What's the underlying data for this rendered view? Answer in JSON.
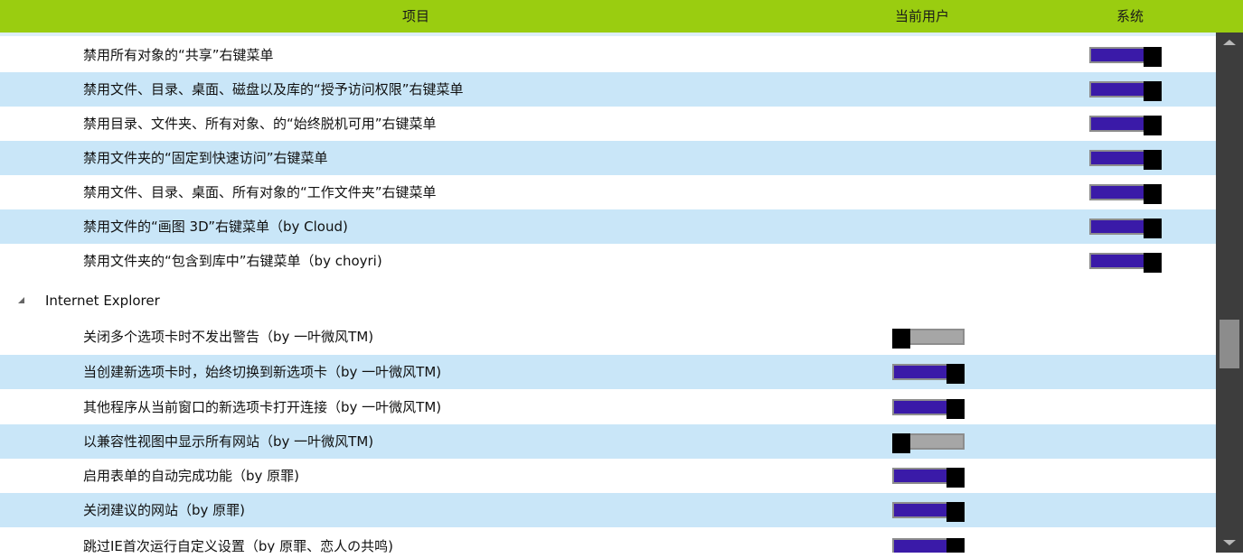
{
  "header": {
    "col_item": "项目",
    "col_user": "当前用户",
    "col_system": "系统"
  },
  "rows": [
    {
      "type": "item",
      "label": "禁用所有对象的“共享”右键菜单",
      "system": true
    },
    {
      "type": "item",
      "label": "禁用文件、目录、桌面、磁盘以及库的“授予访问权限”右键菜单",
      "system": true
    },
    {
      "type": "item",
      "label": "禁用目录、文件夹、所有对象、的“始终脱机可用”右键菜单",
      "system": true
    },
    {
      "type": "item",
      "label": "禁用文件夹的“固定到快速访问”右键菜单",
      "system": true
    },
    {
      "type": "item",
      "label": "禁用文件、目录、桌面、所有对象的“工作文件夹”右键菜单",
      "system": true
    },
    {
      "type": "item",
      "label": "禁用文件的“画图 3D”右键菜单（by Cloud)",
      "system": true
    },
    {
      "type": "item",
      "label": "禁用文件夹的“包含到库中”右键菜单（by choyri)",
      "system": true
    },
    {
      "type": "group",
      "label": "Internet Explorer"
    },
    {
      "type": "item",
      "label": "关闭多个选项卡时不发出警告（by 一叶微风TM)",
      "user": false
    },
    {
      "type": "item",
      "label": "当创建新选项卡时，始终切换到新选项卡（by 一叶微风TM)",
      "user": true
    },
    {
      "type": "item",
      "label": "其他程序从当前窗口的新选项卡打开连接（by 一叶微风TM)",
      "user": true
    },
    {
      "type": "item",
      "label": "以兼容性视图中显示所有网站（by 一叶微风TM)",
      "user": false
    },
    {
      "type": "item",
      "label": "启用表单的自动完成功能（by 原罪)",
      "user": true
    },
    {
      "type": "item",
      "label": "关闭建议的网站（by 原罪)",
      "user": true
    },
    {
      "type": "item",
      "label": "跳过IE首次运行自定义设置（by 原罪、恋人の共鸣)",
      "user": true
    }
  ],
  "icons": {
    "group_expand": "expanded-triangle-icon",
    "scroll_up": "scroll-up-arrow-icon",
    "scroll_down": "scroll-down-arrow-icon"
  },
  "colors": {
    "header_bg": "#9acd10",
    "row_alt_bg": "#c9e6f8",
    "toggle_on": "#3a1aa8",
    "toggle_off": "#a6a6a6",
    "scrollbar": "#3d3d3d"
  }
}
